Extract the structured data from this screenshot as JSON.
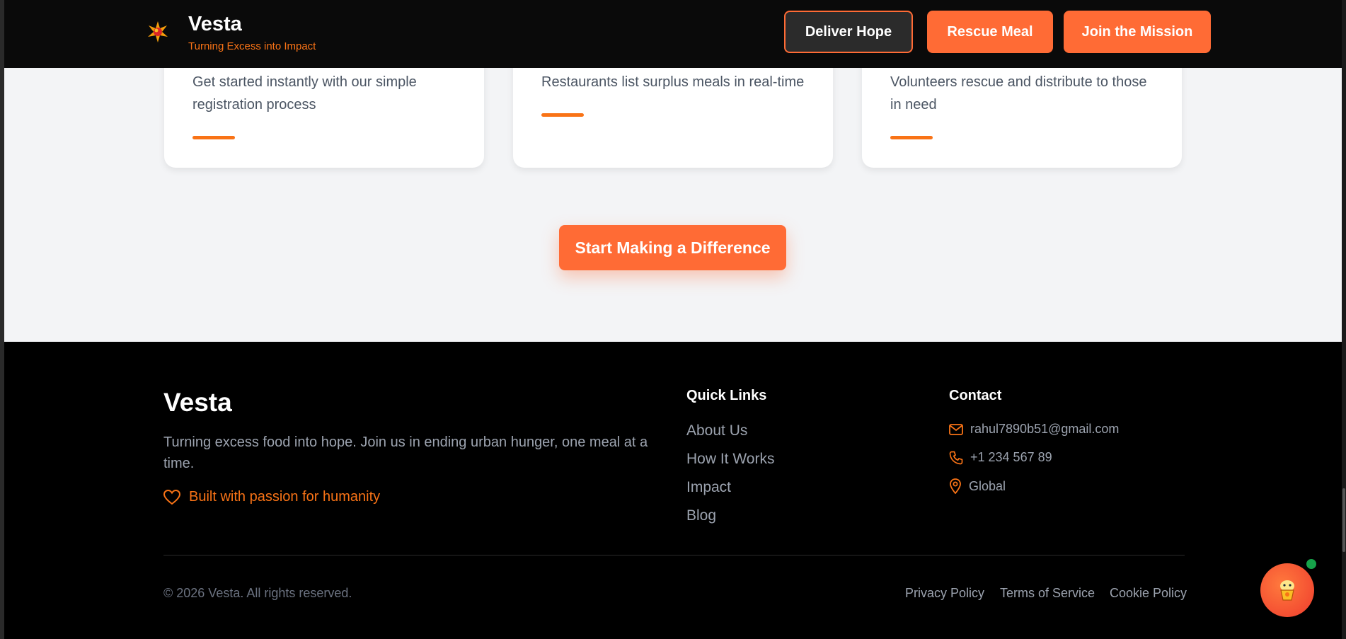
{
  "header": {
    "brand": "Vesta",
    "tagline": "Turning Excess into Impact",
    "buttons": {
      "deliver": "Deliver Hope",
      "rescue": "Rescue Meal",
      "join": "Join the Mission"
    }
  },
  "cards": [
    {
      "desc": "Get started instantly with our simple registration process"
    },
    {
      "desc": "Restaurants list surplus meals in real-time"
    },
    {
      "desc": "Volunteers rescue and distribute to those in need"
    }
  ],
  "cta": {
    "label": "Start Making a Difference"
  },
  "footer": {
    "brand": "Vesta",
    "description": "Turning excess food into hope. Join us in ending urban hunger, one meal at a time.",
    "passion": "Built with passion for humanity",
    "quick_links": {
      "title": "Quick Links",
      "items": [
        "About Us",
        "How It Works",
        "Impact",
        "Blog"
      ]
    },
    "contact": {
      "title": "Contact",
      "email": "rahul7890b51@gmail.com",
      "phone": "+1 234 567 89",
      "location": "Global"
    },
    "copyright": "© 2026 Vesta. All rights reserved.",
    "policies": {
      "privacy": "Privacy Policy",
      "terms": "Terms of Service",
      "cookie": "Cookie Policy"
    }
  },
  "icons": {
    "logo": "sunburst-logo-icon",
    "heart": "heart-icon",
    "mail": "mail-icon",
    "phone": "phone-icon",
    "location": "map-pin-icon",
    "chat": "chat-assistant-icon"
  },
  "colors": {
    "accent": "#ff6b35",
    "accent_text": "#f97316",
    "online": "#16a34a"
  }
}
